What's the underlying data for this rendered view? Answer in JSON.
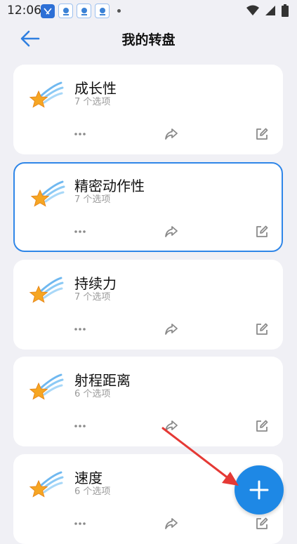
{
  "status_bar": {
    "time": "12:06"
  },
  "header": {
    "title": "我的转盘"
  },
  "cards": [
    {
      "name": "成长性",
      "count": "7 个选项"
    },
    {
      "name": "精密动作性",
      "count": "7 个选项"
    },
    {
      "name": "持续力",
      "count": "7 个选项"
    },
    {
      "name": "射程距离",
      "count": "6 个选项"
    },
    {
      "name": "速度",
      "count": "6 个选项"
    }
  ],
  "selected_card_index": 1,
  "colors": {
    "accent": "#1e88e5",
    "selected_border": "#2f86e8",
    "background": "#f0f0f5",
    "annotation_arrow": "#e53935"
  },
  "icons": {
    "card": "shooting-star-icon",
    "more": "more-icon",
    "share": "share-icon",
    "edit": "edit-icon",
    "back": "back-arrow-icon",
    "fab": "plus-icon"
  }
}
